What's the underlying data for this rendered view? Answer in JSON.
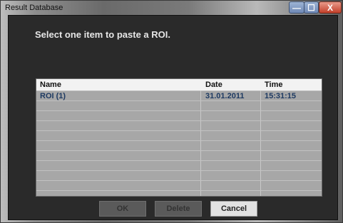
{
  "window": {
    "title": "Result Database",
    "controls": {
      "minimize_label": "—",
      "maximize_label": "☐",
      "close_label": "X"
    }
  },
  "prompt": "Select one item to paste a ROI.",
  "table": {
    "headers": {
      "name": "Name",
      "date": "Date",
      "time": "Time"
    },
    "rows": [
      {
        "name": "ROI (1)",
        "date": "31.01.2011",
        "time": "15:31:15"
      }
    ]
  },
  "buttons": {
    "ok_label": "OK",
    "delete_label": "Delete",
    "cancel_label": "Cancel"
  }
}
